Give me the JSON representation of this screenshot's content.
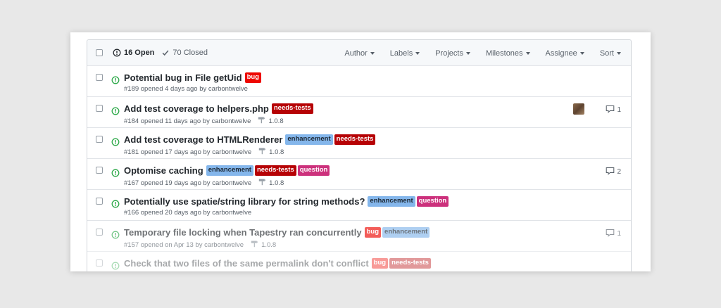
{
  "header": {
    "open_label": "16 Open",
    "closed_label": "70 Closed",
    "filters": [
      "Author",
      "Labels",
      "Projects",
      "Milestones",
      "Assignee",
      "Sort"
    ]
  },
  "issues": [
    {
      "title": "Potential bug in File getUid",
      "labels": [
        "bug"
      ],
      "meta": "#189 opened 4 days ago by carbontwelve",
      "milestone": "",
      "comments": ""
    },
    {
      "title": "Add test coverage to helpers.php",
      "labels": [
        "needs-tests"
      ],
      "meta": "#184 opened 11 days ago by carbontwelve",
      "milestone": "1.0.8",
      "comments": "1"
    },
    {
      "title": "Add test coverage to HTMLRenderer",
      "labels": [
        "enhancement",
        "needs-tests"
      ],
      "meta": "#181 opened 17 days ago by carbontwelve",
      "milestone": "1.0.8",
      "comments": ""
    },
    {
      "title": "Optomise caching",
      "labels": [
        "enhancement",
        "needs-tests",
        "question"
      ],
      "meta": "#167 opened 19 days ago by carbontwelve",
      "milestone": "1.0.8",
      "comments": "2"
    },
    {
      "title": "Potentially use spatie/string library for string methods?",
      "labels": [
        "enhancement",
        "question"
      ],
      "meta": "#166 opened 20 days ago by carbontwelve",
      "milestone": "",
      "comments": ""
    },
    {
      "title": "Temporary file locking when Tapestry ran concurrently",
      "labels": [
        "bug",
        "enhancement"
      ],
      "meta": "#157 opened on Apr 13 by carbontwelve",
      "milestone": "1.0.8",
      "comments": "1"
    },
    {
      "title": "Check that two files of the same permalink don't conflict",
      "labels": [
        "bug",
        "needs-tests"
      ],
      "meta": "",
      "milestone": "",
      "comments": ""
    }
  ],
  "colors": {
    "open_green": "#28a745",
    "label_bug": "#ee0701",
    "label_needs_tests": "#b60205",
    "label_enhancement": "#84b6eb",
    "label_question": "#cc317c"
  },
  "icons": {
    "open": "issue-opened-icon",
    "closed": "check-icon",
    "milestone": "milestone-icon",
    "comment": "comment-icon"
  }
}
